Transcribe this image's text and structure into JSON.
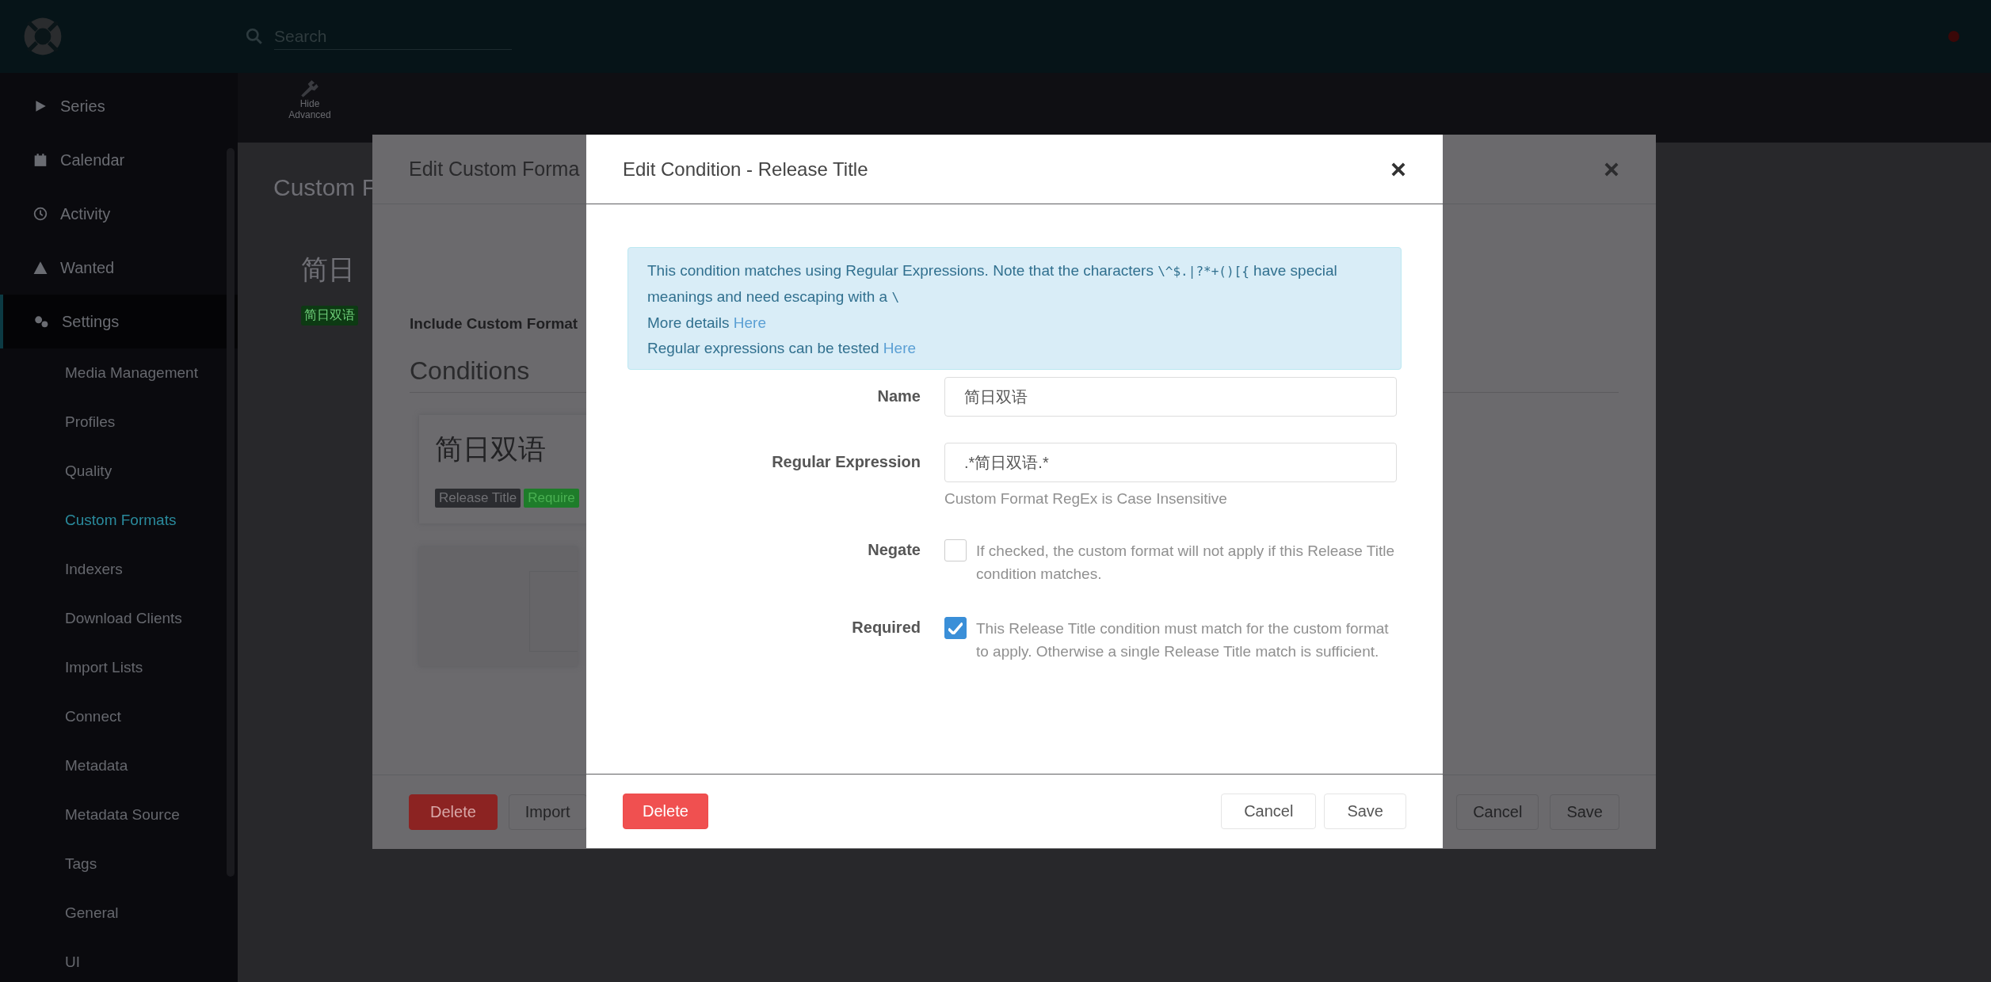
{
  "header": {
    "search": {
      "placeholder": "Search"
    }
  },
  "sidebar": {
    "items": [
      {
        "label": "Series",
        "selected": false
      },
      {
        "label": "Calendar",
        "selected": false
      },
      {
        "label": "Activity",
        "selected": false
      },
      {
        "label": "Wanted",
        "selected": false
      },
      {
        "label": "Settings",
        "selected": true,
        "children": [
          {
            "label": "Media Management",
            "selected": false
          },
          {
            "label": "Profiles",
            "selected": false
          },
          {
            "label": "Quality",
            "selected": false
          },
          {
            "label": "Custom Formats",
            "selected": true
          },
          {
            "label": "Indexers",
            "selected": false
          },
          {
            "label": "Download Clients",
            "selected": false
          },
          {
            "label": "Import Lists",
            "selected": false
          },
          {
            "label": "Connect",
            "selected": false
          },
          {
            "label": "Metadata",
            "selected": false
          },
          {
            "label": "Metadata Source",
            "selected": false
          },
          {
            "label": "Tags",
            "selected": false
          },
          {
            "label": "General",
            "selected": false
          },
          {
            "label": "UI",
            "selected": false
          }
        ]
      }
    ]
  },
  "toolbar": {
    "buttons": [
      {
        "label": "Hide Advanced"
      }
    ]
  },
  "page": {
    "title": "Custom F",
    "cards": [
      {
        "name": "简日",
        "tags": [
          "简日双语"
        ]
      }
    ]
  },
  "edit_custom_format_modal": {
    "title": "Edit Custom Forma",
    "include_label": "Include Custom Format",
    "conditions_heading": "Conditions",
    "conditions": [
      {
        "name": "简日双语",
        "tags": [
          {
            "label": "Release Title",
            "kind": "type"
          },
          {
            "label": "Require",
            "kind": "required"
          }
        ]
      }
    ],
    "buttons": [
      {
        "label": "Delete",
        "kind": "danger"
      },
      {
        "label": "Import",
        "kind": "default"
      },
      {
        "label": "Cancel",
        "kind": "default"
      },
      {
        "label": "Save",
        "kind": "default"
      }
    ]
  },
  "edit_condition_modal": {
    "title": "Edit Condition - Release Title",
    "info": {
      "paragraph": [
        {
          "kind": "text",
          "text": "This condition matches using Regular Expressions. Note that the characters "
        },
        {
          "kind": "code",
          "text": "\\^$.|?*+()[{"
        },
        {
          "kind": "text",
          "text": " have special meanings and need escaping with a "
        },
        {
          "kind": "code",
          "text": "\\"
        }
      ],
      "links": [
        {
          "text": "More details",
          "link": "Here"
        },
        {
          "text": "Regular expressions can be tested",
          "link": "Here"
        }
      ]
    },
    "fields": [
      {
        "label": "Name",
        "kind": "text",
        "value": "简日双语"
      },
      {
        "label": "Regular Expression",
        "kind": "text",
        "value": ".*简日双语.*",
        "help": "Custom Format RegEx is Case Insensitive"
      },
      {
        "label": "Negate",
        "kind": "checkbox",
        "checked": false,
        "help": "If checked, the custom format will not apply if this Release Title condition matches."
      },
      {
        "label": "Required",
        "kind": "checkbox",
        "checked": true,
        "help": "This Release Title condition must match for the custom format to apply. Otherwise a single Release Title match is sufficient."
      }
    ],
    "buttons": [
      {
        "label": "Delete",
        "kind": "danger"
      },
      {
        "label": "Cancel",
        "kind": "default"
      },
      {
        "label": "Save",
        "kind": "default"
      }
    ]
  }
}
